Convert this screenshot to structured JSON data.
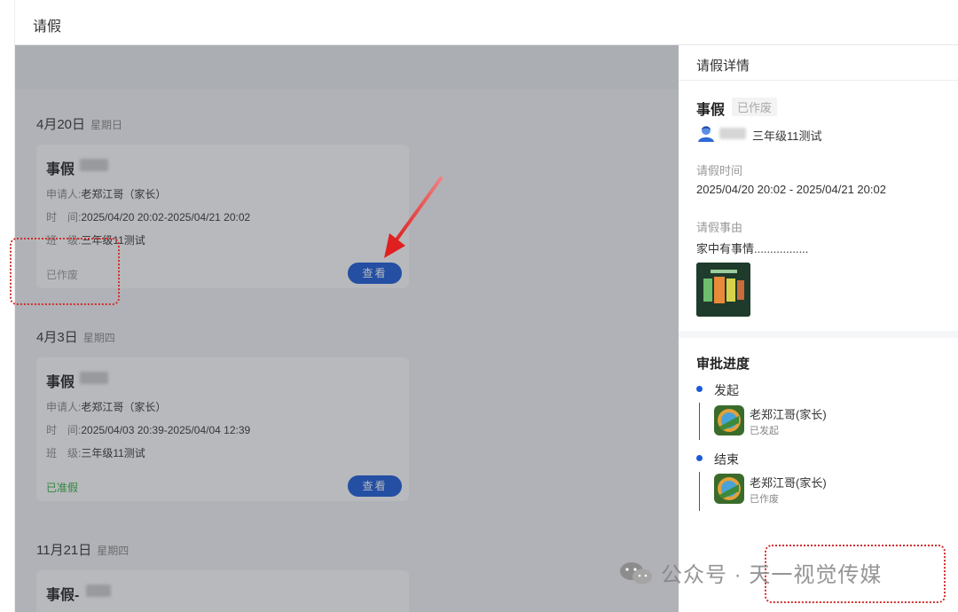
{
  "app": {
    "title": "请假"
  },
  "list": {
    "groups": [
      {
        "date": "4月20日",
        "weekday": "星期日",
        "card": {
          "title": "事假",
          "applicant_key": "申请人:",
          "applicant": "老郑江哥（家长）",
          "time_key": "时　间:",
          "time": "2025/04/20 20:02-2025/04/21 20:02",
          "class_key": "班　级:",
          "class": "三年级11测试",
          "status": "已作废",
          "button": "查看"
        }
      },
      {
        "date": "4月3日",
        "weekday": "星期四",
        "card": {
          "title": "事假",
          "applicant_key": "申请人:",
          "applicant": "老郑江哥（家长）",
          "time_key": "时　间:",
          "time": "2025/04/03 20:39-2025/04/04 12:39",
          "class_key": "班　级:",
          "class": "三年级11测试",
          "status": "已准假",
          "button": "查看"
        }
      },
      {
        "date": "11月21日",
        "weekday": "星期四",
        "card": {
          "title": "事假-"
        }
      }
    ]
  },
  "detail": {
    "header": "请假详情",
    "type": "事假",
    "badge": "已作废",
    "class": "三年级11测试",
    "time_label": "请假时间",
    "time_value": "2025/04/20 20:02 - 2025/04/21 20:02",
    "reason_label": "请假事由",
    "reason_value": "家中有事情.................",
    "progress_title": "审批进度",
    "steps": [
      {
        "label": "发起",
        "name": "老郑江哥(家长)",
        "sub": "已发起"
      },
      {
        "label": "结束",
        "name": "老郑江哥(家长)",
        "sub": "已作废"
      }
    ]
  },
  "watermark": "公众号 · 天一视觉传媒",
  "colors": {
    "accent": "#1a5ad8",
    "approved": "#2fae3c",
    "annotation": "#d12f2f"
  }
}
